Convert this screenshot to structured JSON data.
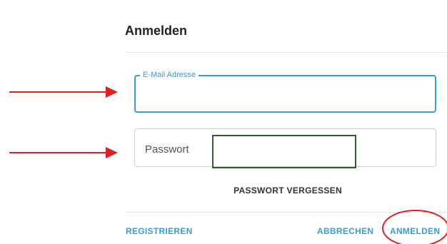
{
  "dialog": {
    "title": "Anmelden"
  },
  "email_field": {
    "label": "E-Mail Adresse",
    "value": ""
  },
  "password_field": {
    "placeholder": "Passwort",
    "value": ""
  },
  "forgot_password_label": "PASSWORT VERGESSEN",
  "actions": {
    "register_label": "REGISTRIEREN",
    "cancel_label": "ABBRECHEN",
    "login_label": "ANMELDEN"
  },
  "colors": {
    "accent": "#3a9bd6",
    "annotation_red": "#e02020",
    "annotation_green": "#2e5f26"
  },
  "annotations": {
    "arrows": [
      "red-arrow",
      "red-arrow"
    ],
    "highlight_box": "green-rectangle",
    "highlight_ellipse": "red-ellipse"
  }
}
